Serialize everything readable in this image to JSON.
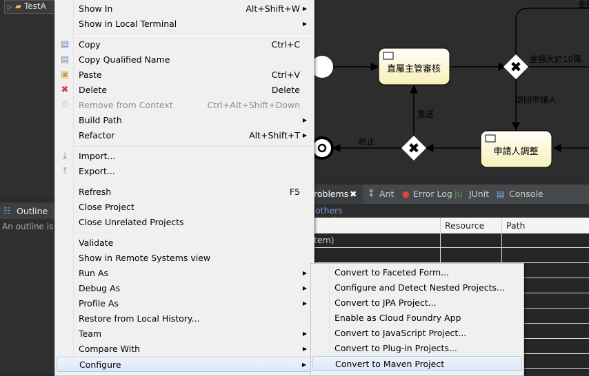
{
  "explorer": {
    "project_label": "TestA"
  },
  "outline": {
    "tab_label": "Outline",
    "message": "An outline is n"
  },
  "diagram": {
    "tasks": [
      "直屬主管審核",
      "申請人調整"
    ],
    "flow_labels": {
      "amount_over": "金額大於10萬",
      "return": "退回申請人",
      "resend": "重送",
      "terminate": "終止",
      "top_cut": "金額"
    }
  },
  "bottom_panel": {
    "tabs": [
      "roblems",
      "Ant",
      "Error Log",
      "JUnit",
      "Console"
    ],
    "filter_link": "others",
    "columns": [
      "Resource",
      "Path"
    ],
    "first_row_text": "tem)"
  },
  "context_menu": {
    "items": [
      {
        "label": "Show In",
        "shortcut": "Alt+Shift+W",
        "submenu": true
      },
      {
        "label": "Show in Local Terminal",
        "submenu": true
      },
      {
        "sep": true
      },
      {
        "label": "Copy",
        "shortcut": "Ctrl+C",
        "icon": "copy-icon"
      },
      {
        "label": "Copy Qualified Name",
        "icon": "copy-qualified-icon"
      },
      {
        "label": "Paste",
        "shortcut": "Ctrl+V",
        "icon": "paste-icon"
      },
      {
        "label": "Delete",
        "shortcut": "Delete",
        "icon": "delete-icon"
      },
      {
        "label": "Remove from Context",
        "shortcut": "Ctrl+Alt+Shift+Down",
        "icon": "remove-context-icon",
        "disabled": true
      },
      {
        "label": "Build Path",
        "submenu": true
      },
      {
        "label": "Refactor",
        "shortcut": "Alt+Shift+T",
        "submenu": true
      },
      {
        "sep": true
      },
      {
        "label": "Import...",
        "icon": "import-icon"
      },
      {
        "label": "Export...",
        "icon": "export-icon"
      },
      {
        "sep": true
      },
      {
        "label": "Refresh",
        "shortcut": "F5"
      },
      {
        "label": "Close Project"
      },
      {
        "label": "Close Unrelated Projects"
      },
      {
        "sep": true
      },
      {
        "label": "Validate"
      },
      {
        "label": "Show in Remote Systems view"
      },
      {
        "label": "Run As",
        "submenu": true
      },
      {
        "label": "Debug As",
        "submenu": true
      },
      {
        "label": "Profile As",
        "submenu": true
      },
      {
        "label": "Restore from Local History..."
      },
      {
        "label": "Team",
        "submenu": true
      },
      {
        "label": "Compare With",
        "submenu": true
      },
      {
        "label": "Configure",
        "submenu": true,
        "highlighted": true
      }
    ]
  },
  "configure_submenu": {
    "items": [
      {
        "label": "Convert to Faceted Form..."
      },
      {
        "label": "Configure and Detect Nested Projects..."
      },
      {
        "label": "Convert to JPA Project..."
      },
      {
        "label": "Enable as Cloud Foundry App"
      },
      {
        "label": "Convert to JavaScript Project..."
      },
      {
        "label": "Convert to Plug-in Projects..."
      },
      {
        "label": "Convert to Maven Project",
        "highlighted": true
      }
    ]
  }
}
